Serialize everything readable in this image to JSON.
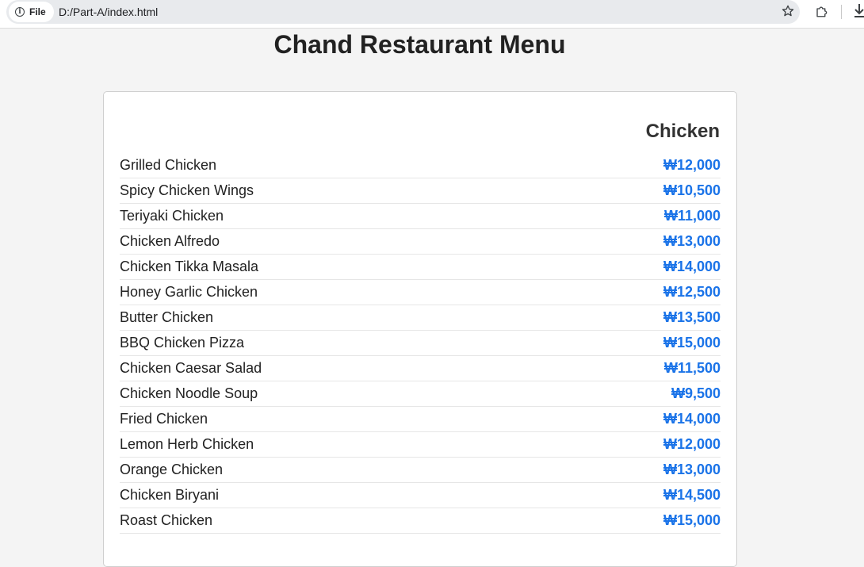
{
  "browser": {
    "site_chip_label": "File",
    "url": "D:/Part-A/index.html",
    "icons": [
      "info-icon",
      "star-icon",
      "extensions-icon",
      "download-icon"
    ]
  },
  "page": {
    "title": "Chand Restaurant Menu"
  },
  "menu": {
    "category": "Chicken",
    "items": [
      {
        "name": "Grilled Chicken",
        "price": "₩12,000"
      },
      {
        "name": "Spicy Chicken Wings",
        "price": "₩10,500"
      },
      {
        "name": "Teriyaki Chicken",
        "price": "₩11,000"
      },
      {
        "name": "Chicken Alfredo",
        "price": "₩13,000"
      },
      {
        "name": "Chicken Tikka Masala",
        "price": "₩14,000"
      },
      {
        "name": "Honey Garlic Chicken",
        "price": "₩12,500"
      },
      {
        "name": "Butter Chicken",
        "price": "₩13,500"
      },
      {
        "name": "BBQ Chicken Pizza",
        "price": "₩15,000"
      },
      {
        "name": "Chicken Caesar Salad",
        "price": "₩11,500"
      },
      {
        "name": "Chicken Noodle Soup",
        "price": "₩9,500"
      },
      {
        "name": "Fried Chicken",
        "price": "₩14,000"
      },
      {
        "name": "Lemon Herb Chicken",
        "price": "₩12,000"
      },
      {
        "name": "Orange Chicken",
        "price": "₩13,000"
      },
      {
        "name": "Chicken Biryani",
        "price": "₩14,500"
      },
      {
        "name": "Roast Chicken",
        "price": "₩15,000"
      }
    ]
  },
  "colors": {
    "price": "#1a73e8",
    "background": "#f4f4f4",
    "card": "#ffffff"
  }
}
